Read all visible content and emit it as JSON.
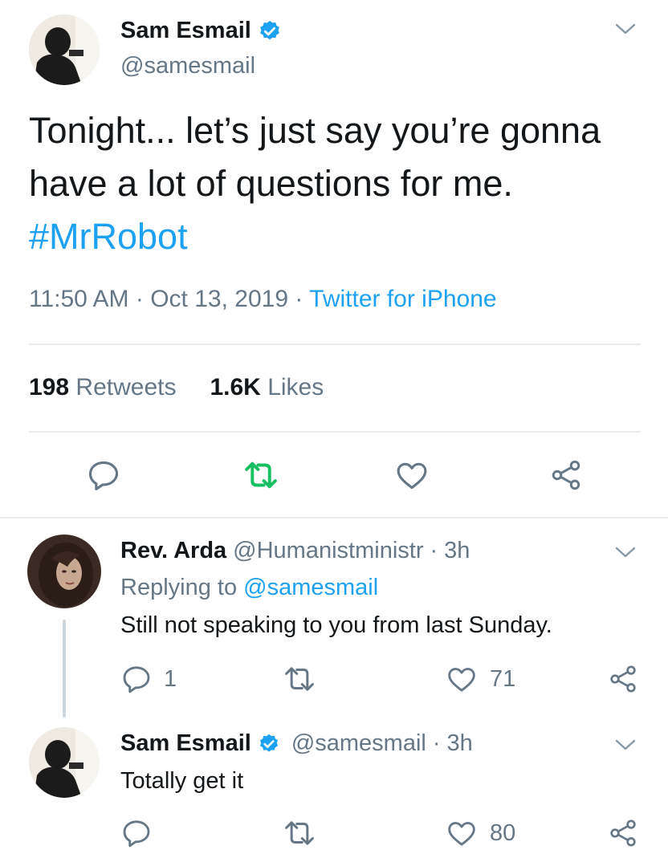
{
  "main_tweet": {
    "author_name": "Sam Esmail",
    "author_handle": "@samesmail",
    "text_plain": "Tonight... let’s just say you’re gonna have a lot of questions for me.",
    "hashtag": "#MrRobot",
    "time": "11:50 AM",
    "date": "Oct 13, 2019",
    "source": "Twitter for iPhone",
    "separator": "·",
    "retweet_count": "198",
    "retweet_label": "Retweets",
    "like_count": "1.6K",
    "like_label": "Likes",
    "icons": [
      "chevron-down-icon",
      "verified-badge-icon",
      "reply-icon",
      "retweet-icon",
      "like-icon",
      "share-icon"
    ],
    "retweet_active_color": "#17bf63"
  },
  "replies": [
    {
      "author_name": "Rev. Arda",
      "author_handle": "@Humanistministr",
      "time": "3h",
      "separator": "·",
      "replying_label": "Replying to",
      "replying_handle": "@samesmail",
      "text": "Still not speaking to you from last Sunday.",
      "reply_count": "1",
      "retweet_count": "",
      "like_count": "71"
    },
    {
      "author_name": "Sam Esmail",
      "author_handle": "@samesmail",
      "time": "3h",
      "separator": "·",
      "text": "Totally get it",
      "reply_count": "",
      "retweet_count": "",
      "like_count": "80"
    }
  ],
  "colors": {
    "accent": "#1da1f2",
    "secondary_text": "#657786",
    "divider": "#e6ecf0"
  }
}
